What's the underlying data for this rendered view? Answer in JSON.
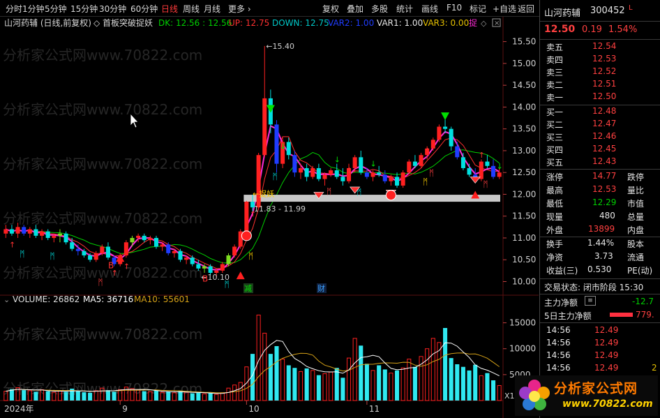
{
  "toolbar": {
    "left": [
      "分时",
      "1分钟",
      "5分钟",
      "15分钟",
      "30分钟",
      "60分钟",
      "日线",
      "周线",
      "月线",
      "更多 ›"
    ],
    "active": "日线",
    "right": [
      "复权",
      "叠加",
      "多股",
      "统计",
      "画线",
      "F10",
      "标记",
      "+自选",
      "返回"
    ]
  },
  "indicator_line": {
    "title": "山河药辅 (日线,前复权)",
    "formula": "首板突破捉妖",
    "dk": "DK: 12.56 : 12.56",
    "up": "UP: 12.75",
    "down": "DOWN: 12.75",
    "var2": "VAR2: 1.00",
    "var1": "VAR1: 1.00",
    "var3": "VAR3: 0.00",
    "tag": "捉"
  },
  "watermark": "分析家公式网www.70822.com",
  "annotations": {
    "high": "15.40",
    "low": "10.10",
    "zhuoyao": "←捉妖",
    "range": "11.83 - 11.99",
    "jian": "减",
    "cai": "财",
    "b1": "B",
    "b2": "B"
  },
  "colors": {
    "up": "#ff2020",
    "down": "#00e0e0",
    "blue": "#1f3cff",
    "ma_green": "#00d000",
    "ma_pink": "#ff2bd6",
    "ma_red": "#ff3030",
    "vol_ma5": "#ffffff",
    "vol_ma10": "#d4a017"
  },
  "price_axis": [
    "15.50",
    "15.00",
    "14.50",
    "14.00",
    "13.50",
    "13.00",
    "12.50",
    "12.00",
    "11.50",
    "11.00",
    "10.50",
    "10.00"
  ],
  "volume_header": {
    "label": "VOLUME: 26862",
    "ma5": "MA5: 36716",
    "ma10": "MA10: 55601"
  },
  "volume_axis": [
    "15000",
    "10000",
    "5000"
  ],
  "volume_unit": "X1",
  "date_axis": [
    "2024年",
    "9",
    "10",
    "11"
  ],
  "chart_data": {
    "type": "candlestick",
    "ylim": [
      9.8,
      15.75
    ],
    "candles": [
      [
        11.1,
        11.3,
        11.0,
        11.2
      ],
      [
        11.2,
        11.3,
        11.05,
        11.1
      ],
      [
        11.1,
        11.35,
        11.0,
        11.25
      ],
      [
        11.25,
        11.3,
        11.05,
        11.1
      ],
      [
        11.1,
        11.25,
        11.0,
        11.2
      ],
      [
        11.2,
        11.3,
        11.0,
        11.05
      ],
      [
        11.05,
        11.2,
        10.95,
        11.15
      ],
      [
        11.15,
        11.2,
        10.95,
        11.0
      ],
      [
        11.0,
        11.1,
        10.9,
        11.05
      ],
      [
        11.05,
        11.2,
        10.9,
        11.1
      ],
      [
        11.1,
        11.15,
        10.85,
        10.9
      ],
      [
        10.9,
        11.0,
        10.7,
        10.75
      ],
      [
        10.75,
        10.85,
        10.6,
        10.7
      ],
      [
        10.7,
        10.75,
        10.55,
        10.6
      ],
      [
        10.6,
        10.65,
        10.45,
        10.5
      ],
      [
        10.5,
        10.7,
        10.45,
        10.65
      ],
      [
        10.65,
        10.85,
        10.6,
        10.8
      ],
      [
        10.8,
        10.9,
        10.5,
        10.55
      ],
      [
        10.55,
        10.6,
        10.35,
        10.4
      ],
      [
        10.4,
        10.65,
        10.35,
        10.6
      ],
      [
        10.6,
        10.95,
        10.55,
        10.9
      ],
      [
        10.9,
        11.05,
        10.8,
        11.0
      ],
      [
        11.0,
        11.1,
        10.9,
        11.05
      ],
      [
        11.05,
        11.1,
        10.9,
        10.95
      ],
      [
        10.95,
        11.05,
        10.85,
        11.0
      ],
      [
        11.0,
        11.05,
        10.75,
        10.8
      ],
      [
        10.8,
        10.9,
        10.7,
        10.85
      ],
      [
        10.85,
        10.9,
        10.6,
        10.65
      ],
      [
        10.65,
        10.75,
        10.55,
        10.7
      ],
      [
        10.7,
        10.75,
        10.45,
        10.5
      ],
      [
        10.5,
        10.6,
        10.4,
        10.55
      ],
      [
        10.55,
        10.6,
        10.35,
        10.4
      ],
      [
        10.4,
        10.5,
        10.25,
        10.3
      ],
      [
        10.3,
        10.4,
        10.2,
        10.35
      ],
      [
        10.35,
        10.4,
        10.15,
        10.2
      ],
      [
        10.2,
        10.3,
        10.1,
        10.25
      ],
      [
        10.25,
        10.45,
        10.2,
        10.4
      ],
      [
        10.4,
        10.65,
        10.35,
        10.6
      ],
      [
        10.6,
        10.85,
        10.55,
        10.8
      ],
      [
        10.8,
        11.2,
        10.75,
        11.15
      ],
      [
        11.15,
        11.85,
        11.1,
        11.83
      ],
      [
        11.83,
        11.99,
        11.6,
        11.7
      ],
      [
        11.7,
        12.95,
        11.65,
        12.9
      ],
      [
        12.9,
        15.4,
        12.85,
        14.2
      ],
      [
        14.2,
        14.4,
        13.4,
        13.6
      ],
      [
        13.6,
        13.7,
        12.5,
        12.7
      ],
      [
        12.7,
        13.3,
        12.6,
        13.2
      ],
      [
        13.2,
        13.3,
        12.8,
        12.9
      ],
      [
        12.9,
        13.0,
        12.4,
        12.5
      ],
      [
        12.5,
        12.7,
        12.35,
        12.6
      ],
      [
        12.6,
        12.7,
        12.3,
        12.4
      ],
      [
        12.4,
        12.65,
        12.35,
        12.6
      ],
      [
        12.6,
        12.7,
        12.3,
        12.35
      ],
      [
        12.35,
        12.5,
        12.2,
        12.45
      ],
      [
        12.45,
        12.6,
        12.4,
        12.55
      ],
      [
        12.55,
        12.7,
        12.35,
        12.4
      ],
      [
        12.4,
        12.6,
        12.2,
        12.3
      ],
      [
        12.3,
        12.7,
        12.25,
        12.6
      ],
      [
        12.6,
        12.9,
        12.5,
        12.85
      ],
      [
        12.85,
        13.0,
        12.45,
        12.5
      ],
      [
        12.5,
        12.6,
        12.35,
        12.4
      ],
      [
        12.4,
        12.55,
        12.3,
        12.5
      ],
      [
        12.5,
        12.65,
        12.4,
        12.45
      ],
      [
        12.45,
        12.55,
        12.25,
        12.3
      ],
      [
        12.3,
        12.45,
        12.2,
        12.4
      ],
      [
        12.4,
        12.5,
        12.15,
        12.2
      ],
      [
        12.2,
        12.55,
        12.15,
        12.5
      ],
      [
        12.5,
        12.8,
        12.45,
        12.75
      ],
      [
        12.75,
        12.9,
        12.6,
        12.65
      ],
      [
        12.65,
        12.95,
        12.6,
        12.9
      ],
      [
        12.9,
        13.1,
        12.8,
        13.05
      ],
      [
        13.05,
        13.3,
        13.0,
        13.25
      ],
      [
        13.25,
        13.6,
        13.2,
        13.55
      ],
      [
        13.55,
        13.8,
        13.4,
        13.5
      ],
      [
        13.5,
        13.55,
        13.0,
        13.1
      ],
      [
        13.1,
        13.2,
        12.8,
        12.85
      ],
      [
        12.85,
        12.95,
        12.55,
        12.6
      ],
      [
        12.6,
        12.7,
        12.4,
        12.45
      ],
      [
        12.45,
        12.6,
        12.3,
        12.35
      ],
      [
        12.35,
        12.8,
        12.3,
        12.75
      ],
      [
        12.75,
        12.9,
        12.6,
        12.65
      ],
      [
        12.65,
        12.8,
        12.35,
        12.4
      ],
      [
        12.4,
        12.6,
        12.35,
        12.5
      ]
    ],
    "volume": [
      1800,
      2200,
      2500,
      2000,
      1900,
      1700,
      2100,
      1800,
      1600,
      1900,
      1700,
      2300,
      1800,
      1600,
      1500,
      1900,
      2400,
      2000,
      1700,
      2100,
      2600,
      2300,
      2000,
      1800,
      1700,
      1900,
      1600,
      1700,
      1500,
      1800,
      1600,
      1400,
      1500,
      1300,
      1400,
      1200,
      1500,
      2400,
      3000,
      3500,
      6500,
      9000,
      16500,
      13000,
      9000,
      10500,
      8000,
      6800,
      6300,
      5600,
      6200,
      5800,
      4900,
      5200,
      5500,
      6300,
      4400,
      8200,
      12000,
      10600,
      7100,
      5800,
      6800,
      6000,
      5300,
      5800,
      6300,
      8000,
      6500,
      8500,
      10000,
      12000,
      11200,
      14000,
      8200,
      7000,
      6500,
      5800,
      6900,
      4800,
      5300,
      3900,
      2900
    ],
    "vol_ylim": [
      0,
      17500
    ]
  },
  "quote": {
    "name": "山河药辅",
    "code": "300452",
    "flag": "L",
    "price": "12.50",
    "change": "0.19",
    "pct": "1.54%",
    "asks": [
      {
        "label": "卖五",
        "price": "12.54"
      },
      {
        "label": "卖四",
        "price": "12.53"
      },
      {
        "label": "卖三",
        "price": "12.52"
      },
      {
        "label": "卖二",
        "price": "12.51"
      },
      {
        "label": "卖一",
        "price": "12.50"
      }
    ],
    "bids": [
      {
        "label": "买一",
        "price": "12.48"
      },
      {
        "label": "买二",
        "price": "12.47"
      },
      {
        "label": "买三",
        "price": "12.46"
      },
      {
        "label": "买四",
        "price": "12.45"
      },
      {
        "label": "买五",
        "price": "12.43"
      }
    ],
    "stats": [
      {
        "l1": "涨停",
        "v1": "14.77",
        "l2": "跌停"
      },
      {
        "l1": "最高",
        "v1": "12.53",
        "l2": "量比"
      },
      {
        "l1": "最低",
        "v1": "12.29",
        "l2": "市值"
      },
      {
        "l1": "现量",
        "v1": "480",
        "l2": "总量"
      },
      {
        "l1": "外盘",
        "v1": "13899",
        "l2": "内盘"
      }
    ],
    "stats2": [
      {
        "l1": "换手",
        "v1": "1.44%",
        "l2": "股本"
      },
      {
        "l1": "净资",
        "v1": "3.73",
        "l2": "流通"
      },
      {
        "l1": "收益(三)",
        "v1": "0.530",
        "l2": "PE(动)"
      }
    ],
    "trade_status": "交易状态: 闭市阶段 15:30",
    "net_flow": {
      "label": "主力净额",
      "value": "-12.7"
    },
    "net_flow5": {
      "label": "5日主力净额",
      "value": "779."
    },
    "ticks": [
      {
        "time": "14:56",
        "price": "12.49",
        "vol": ""
      },
      {
        "time": "14:56",
        "price": "12.49",
        "vol": ""
      },
      {
        "time": "14:56",
        "price": "12.49",
        "vol": ""
      },
      {
        "time": "14:56",
        "price": "12.49",
        "vol": "2"
      }
    ]
  },
  "logo": {
    "text": "分析家公式网",
    "url": "www.70822.com"
  }
}
